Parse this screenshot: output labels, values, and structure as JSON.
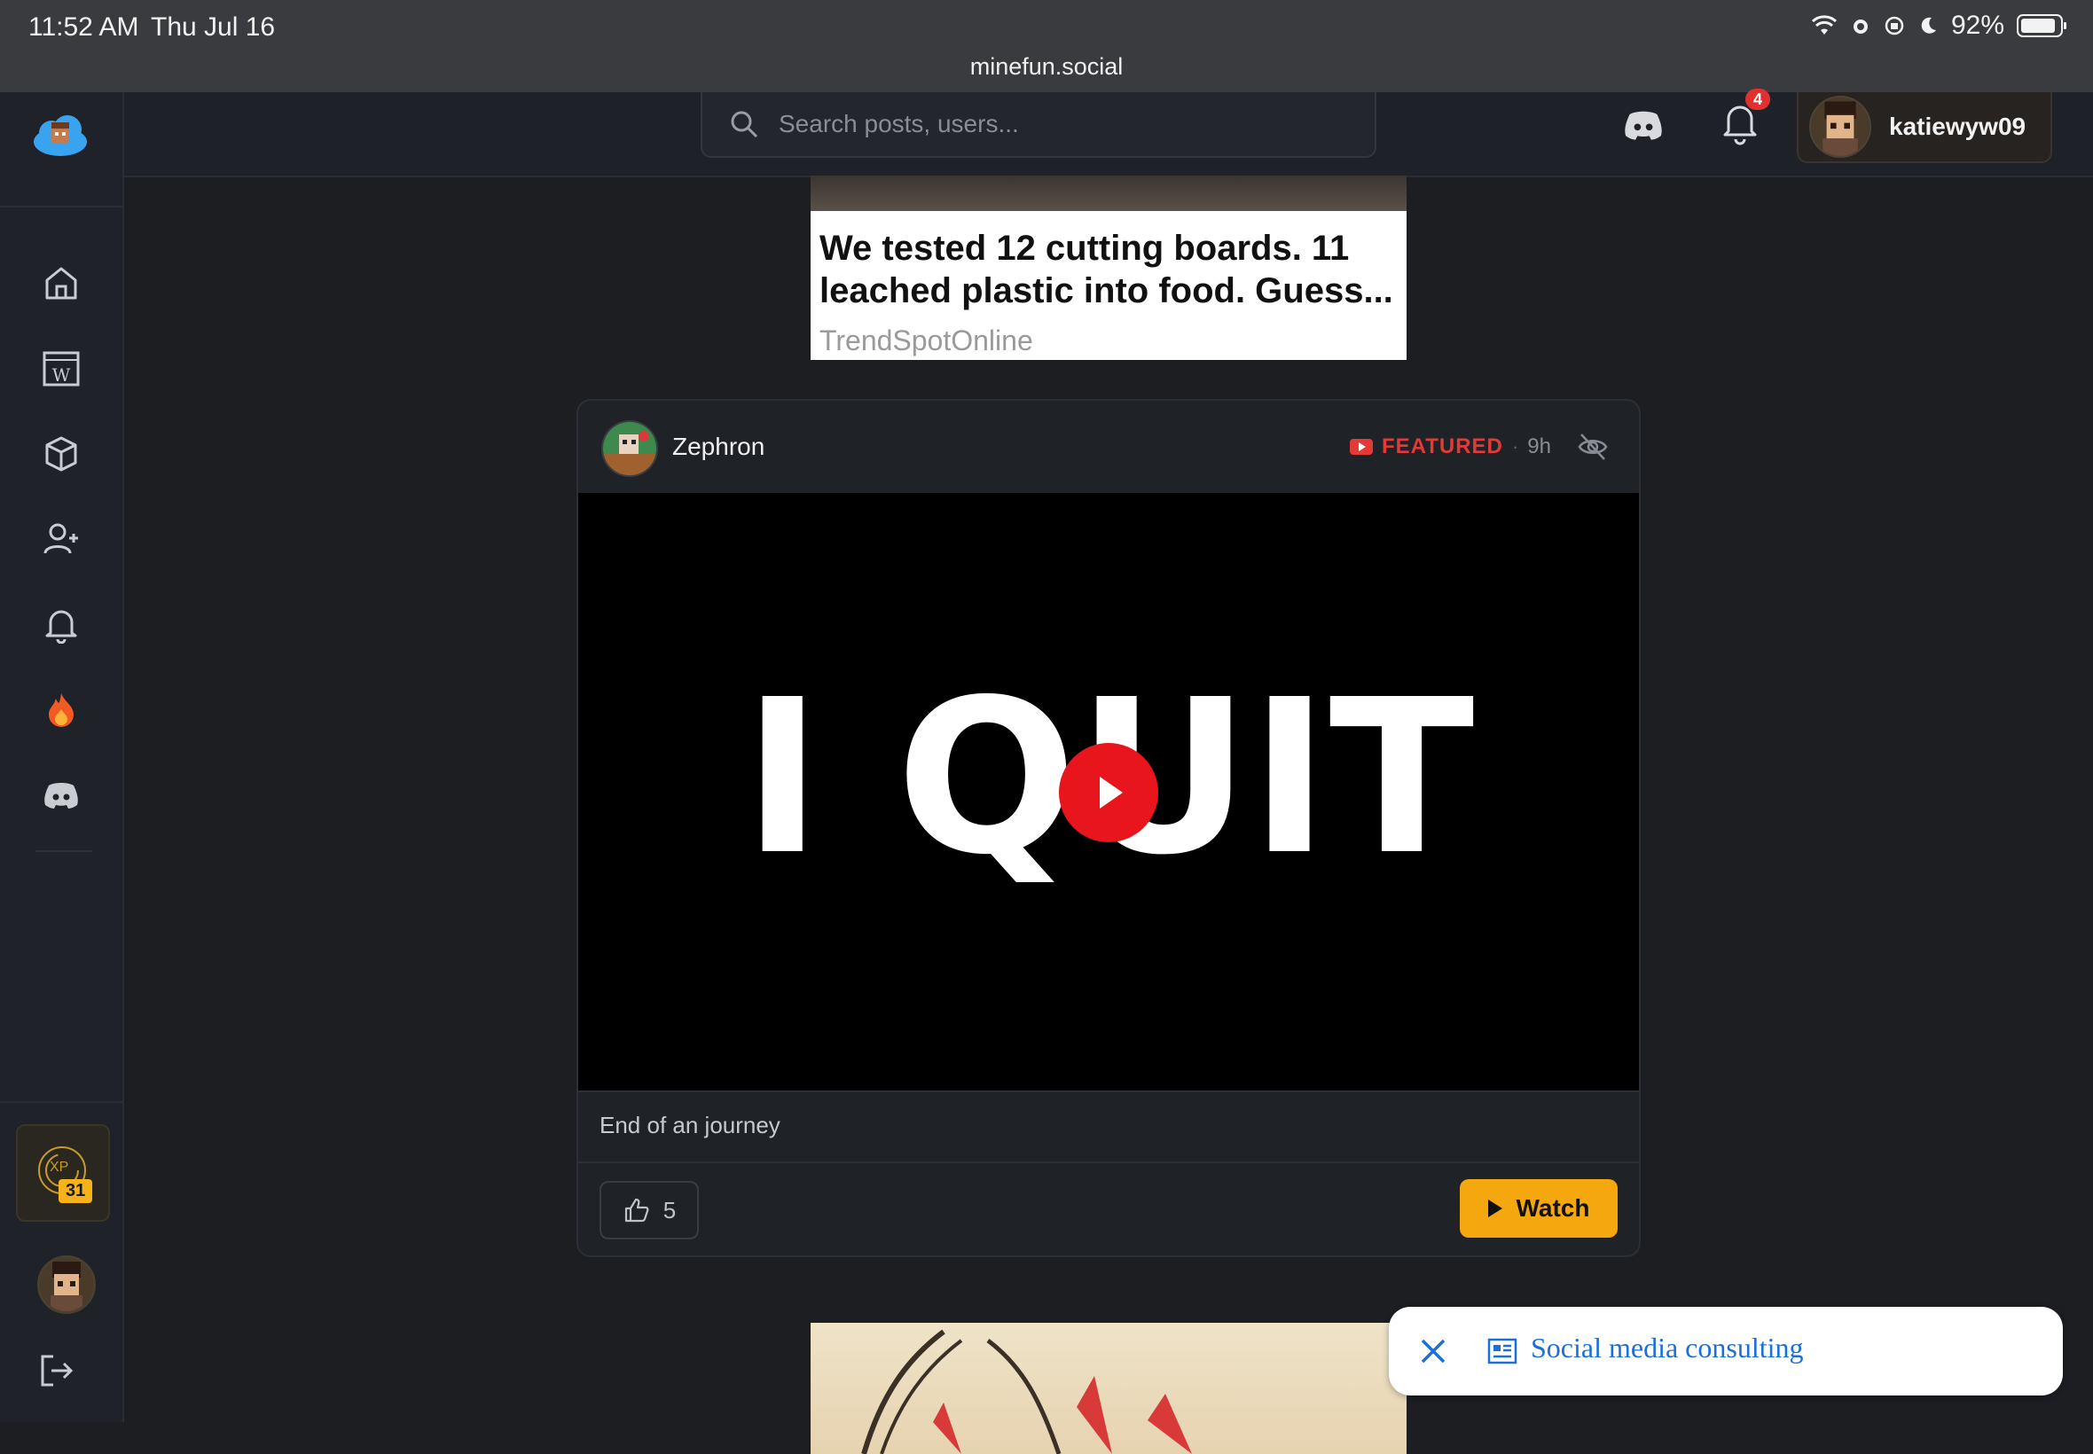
{
  "status_bar": {
    "time": "11:52 AM",
    "date": "Thu Jul 16",
    "battery": "92%",
    "url": "minefun.social"
  },
  "search": {
    "placeholder": "Search posts, users..."
  },
  "header": {
    "notification_count": "4",
    "username": "katiewyw09"
  },
  "sidebar": {
    "items": [
      {
        "icon": "home-icon"
      },
      {
        "icon": "wiki-icon"
      },
      {
        "icon": "cube-icon"
      },
      {
        "icon": "add-user-icon"
      },
      {
        "icon": "bell-icon"
      },
      {
        "icon": "fire-icon"
      },
      {
        "icon": "discord-icon"
      }
    ],
    "xp_label": "XP",
    "xp_level": "31"
  },
  "ad_top": {
    "title": "We tested 12 cutting boards. 11 leached plastic into food. Guess...",
    "source": "TrendSpotOnline"
  },
  "post": {
    "author": "Zephron",
    "featured_label": "FEATURED",
    "separator": "·",
    "age": "9h",
    "video_text": "I QUIT",
    "caption": "End of an journey",
    "likes": "5",
    "watch_label": "Watch"
  },
  "consult_banner": {
    "label": "Social media consulting"
  },
  "colors": {
    "accent": "#f5a70f",
    "featured": "#e53935",
    "link": "#1a6fd8"
  }
}
